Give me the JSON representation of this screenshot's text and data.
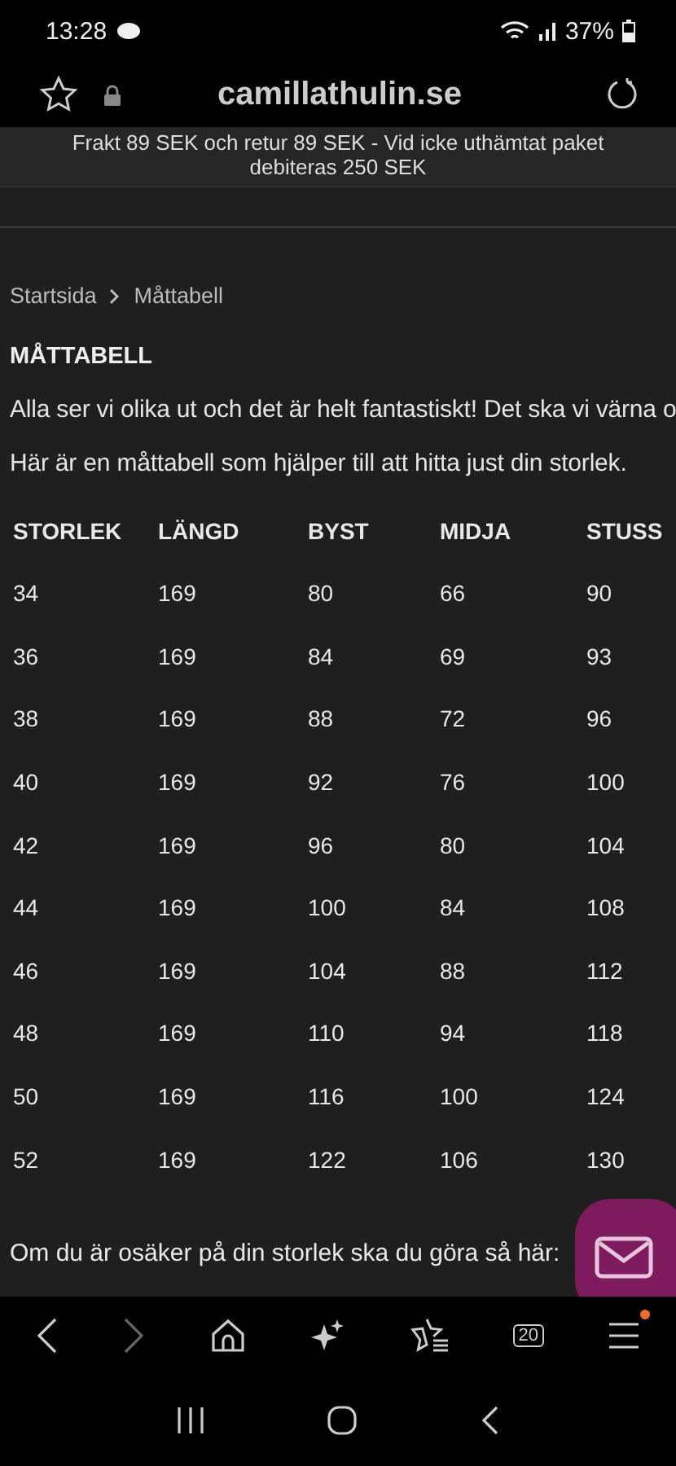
{
  "status_bar": {
    "time": "13:28",
    "battery": "37%"
  },
  "address_bar": {
    "url": "camillathulin.se"
  },
  "banner": {
    "lines": [
      "Frakt 89 SEK och retur 89 SEK - Vid icke uthämtat paket",
      "debiteras 250 SEK"
    ]
  },
  "breadcrumb": [
    {
      "label": "Startsida"
    },
    {
      "label": "Måttabell"
    }
  ],
  "heading": "MÅTTABELL",
  "paragraphs": [
    "Alla ser vi olika ut och det är helt fantastiskt! Det ska vi värna o",
    "Här är en måttabell som hjälper till att hitta just din storlek."
  ],
  "table": {
    "columns": [
      "STORLEK",
      "LÄNGD",
      "BYST",
      "MIDJA",
      "STUSS"
    ],
    "rows": [
      [
        "34",
        "169",
        "80",
        "66",
        "90"
      ],
      [
        "36",
        "169",
        "84",
        "69",
        "93"
      ],
      [
        "38",
        "169",
        "88",
        "72",
        "96"
      ],
      [
        "40",
        "169",
        "92",
        "76",
        "100"
      ],
      [
        "42",
        "169",
        "96",
        "80",
        "104"
      ],
      [
        "44",
        "169",
        "100",
        "84",
        "108"
      ],
      [
        "46",
        "169",
        "104",
        "88",
        "112"
      ],
      [
        "48",
        "169",
        "110",
        "94",
        "118"
      ],
      [
        "50",
        "169",
        "116",
        "100",
        "124"
      ],
      [
        "52",
        "169",
        "122",
        "106",
        "130"
      ]
    ]
  },
  "footer_text": "Om du är osäker på din storlek ska du göra så här:",
  "browser_toolbar": {
    "tabs_count": "20",
    "menu_notification": true
  }
}
